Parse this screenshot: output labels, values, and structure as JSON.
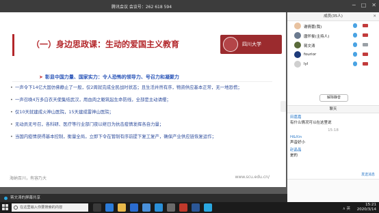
{
  "meeting": {
    "title": "腾讯会议 会议号：262 618 594",
    "window_controls": [
      "─",
      "□",
      "✕"
    ]
  },
  "slide": {
    "title": "（一）身边思政课：生动的爱国主义教育",
    "logo_text": "四川大学",
    "subtitle": "彰显中国力量、国家实力：令人恐怖的领导力、号召力和凝聚力",
    "bullets": [
      "一声令下14亿大国仿佛静止了一般，仅2周就完成全民战时状态；且生活井然有序，物资供应基本正常，无一地恐慌；",
      "一声召唤4万多白衣天使集结武汉，用血肉之躯筑起生命防线，全部是主动请缨；",
      "仅10天就建成火神山医院，15天建成雷神山医院；",
      "无动员无号召，各科研、医疗等行业部门夜以继日为抗击疫情发挥各自力量；",
      "当国内疫情获得基本控制，衡量全局，立即下令在管制有序前提下复工复产，确保产业供应链恢复运作；"
    ],
    "footer_left": "海纳百川，有容乃大",
    "footer_right": "www.scu.edu.cn/"
  },
  "share_bar": {
    "text": "蒋文涛的屏幕共享"
  },
  "panel": {
    "members_title": "成员(35人)",
    "members": [
      {
        "name": "谢倩蕾(我)",
        "avatar_color": "#e8c2a0",
        "cam": "red"
      },
      {
        "name": "唐怀俊(主持人)",
        "avatar_color": "#6b7a8f",
        "cam": "red"
      },
      {
        "name": "蒋文涛",
        "avatar_color": "#5a6b3a",
        "cam": "gray"
      },
      {
        "name": "fourior",
        "avatar_color": "#1e3b7a",
        "cam": "red"
      },
      {
        "name": "lyl",
        "avatar_color": "#cfcfcf",
        "cam": "red"
      }
    ],
    "manage_button": "解除静音",
    "chat_title": "聊天",
    "chat": [
      {
        "sender": "田嘉嘉",
        "message": "有什么情况可以在这里说"
      },
      {
        "time": "15:18"
      },
      {
        "sender": "H&Xin",
        "message": "声音好小"
      },
      {
        "sender": "赵晶晶",
        "message": "是的"
      }
    ],
    "chat_footer_left": "",
    "chat_footer_right": "发送消息"
  },
  "taskbar": {
    "search_placeholder": "在这里输入你要搜索的内容",
    "time": "15:21",
    "date": "2020/3/14",
    "tray_text": "∧ 英",
    "icons": [
      {
        "name": "task-view-icon",
        "color": "#3a3a3a"
      },
      {
        "name": "edge-icon",
        "color": "#2b7bd8"
      },
      {
        "name": "folder-icon",
        "color": "#e8b84a"
      },
      {
        "name": "store-icon",
        "color": "#2b6cd0"
      },
      {
        "name": "mail-icon",
        "color": "#4a90d9"
      },
      {
        "name": "ie-icon",
        "color": "#2a8fd8"
      },
      {
        "name": "photo-icon",
        "color": "#6a6a6a"
      },
      {
        "name": "media-icon",
        "color": "#c0392b"
      },
      {
        "name": "word-icon",
        "color": "#2b5797"
      },
      {
        "name": "meeting-icon",
        "color": "#2aa7e0"
      }
    ]
  }
}
